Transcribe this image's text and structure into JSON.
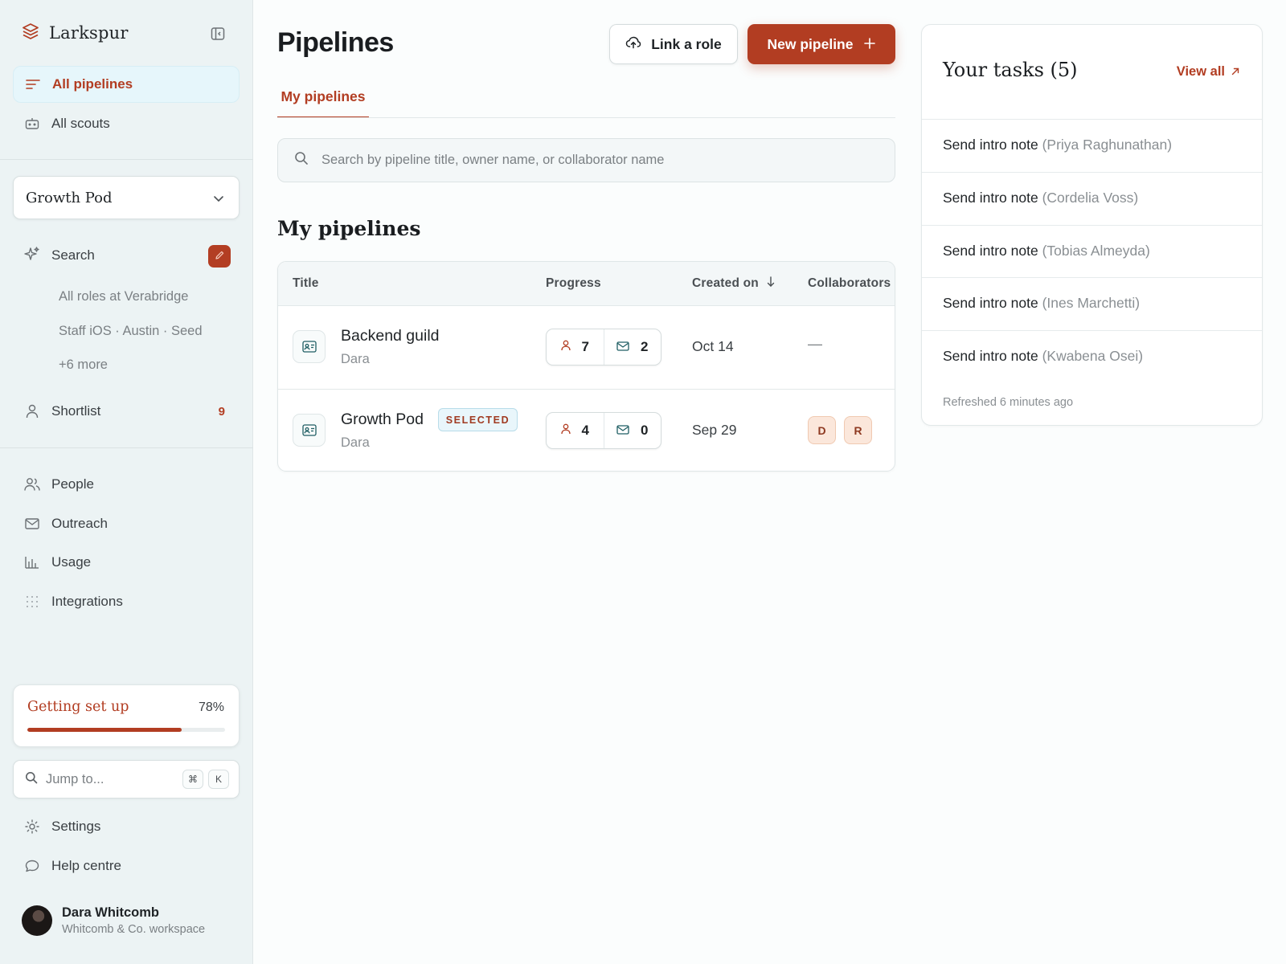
{
  "brand": {
    "name": "Larkspur"
  },
  "nav": {
    "all_pipelines": "All pipelines",
    "all_scouts": "All scouts"
  },
  "pod_select": {
    "value": "Growth Pod"
  },
  "search_section": {
    "label": "Search",
    "sub_items": [
      "All roles at Verabridge",
      "Staff iOS · Austin · Seed",
      "+6 more"
    ]
  },
  "shortlist": {
    "label": "Shortlist",
    "count": "9"
  },
  "secondary_nav": {
    "people": "People",
    "outreach": "Outreach",
    "usage": "Usage",
    "integrations": "Integrations"
  },
  "setup": {
    "title": "Getting set up",
    "percent_label": "78%",
    "progress": 0.78
  },
  "jump": {
    "placeholder": "Jump to...",
    "key1": "⌘",
    "key2": "K"
  },
  "footer_nav": {
    "settings": "Settings",
    "help": "Help centre"
  },
  "user": {
    "name": "Dara Whitcomb",
    "workspace": "Whitcomb & Co. workspace"
  },
  "main": {
    "title": "Pipelines",
    "link_role_label": "Link a role",
    "new_pipeline_label": "New pipeline",
    "tab_label": "My pipelines",
    "search_placeholder": "Search by pipeline title, owner name, or collaborator name",
    "section_title": "My pipelines"
  },
  "table": {
    "headers": {
      "title": "Title",
      "progress": "Progress",
      "created_on": "Created on",
      "collaborators": "Collaborators"
    },
    "rows": [
      {
        "title": "Backend guild",
        "owner": "Dara",
        "people": "7",
        "messages": "2",
        "created": "Oct 14",
        "collaborators": "—",
        "selected_label": ""
      },
      {
        "title": "Growth Pod",
        "owner": "Dara",
        "people": "4",
        "messages": "0",
        "created": "Sep 29",
        "collab_1": "D",
        "collab_2": "R",
        "selected_label": "SELECTED"
      }
    ]
  },
  "tasks": {
    "title": "Your tasks (5)",
    "view_all": "View all",
    "items": [
      {
        "action": "Send intro note",
        "who": "(Priya Raghunathan)"
      },
      {
        "action": "Send intro note",
        "who": "(Cordelia Voss)"
      },
      {
        "action": "Send intro note",
        "who": "(Tobias Almeyda)"
      },
      {
        "action": "Send intro note",
        "who": "(Ines Marchetti)"
      },
      {
        "action": "Send intro note",
        "who": "(Kwabena Osei)"
      }
    ],
    "refreshed": "Refreshed 6 minutes ago"
  },
  "colors": {
    "accent": "#b23d22",
    "sidebar_bg": "#ecf3f4",
    "selected_badge_bg": "#e9f6fb"
  }
}
